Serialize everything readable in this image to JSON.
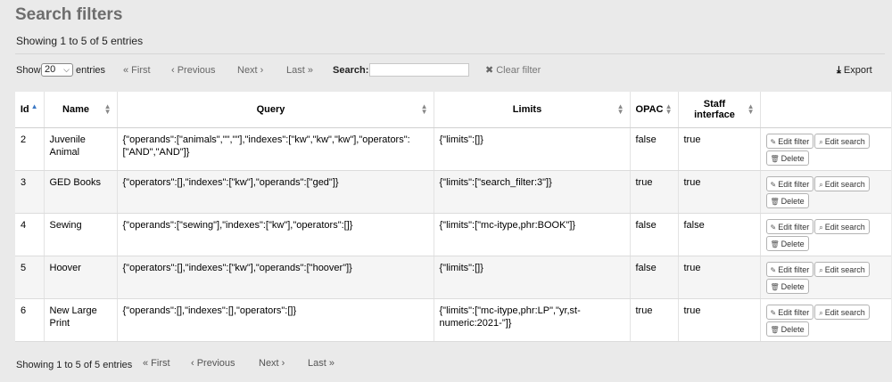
{
  "page": {
    "title": "Search filters",
    "info_top": "Showing 1 to 5 of 5 entries",
    "info_bottom": "Showing 1 to 5 of 5 entries"
  },
  "toolbar": {
    "show_label": "Show",
    "show_value": "20",
    "entries_label": "entries",
    "first": "« First",
    "previous": "‹ Previous",
    "next": "Next ›",
    "last": "Last »",
    "search_label": "Search:",
    "search_value": "",
    "clear_filter": "Clear filter",
    "export": "Export"
  },
  "table": {
    "headers": [
      "Id",
      "Name",
      "Query",
      "Limits",
      "OPAC",
      "Staff interface",
      ""
    ],
    "rows": [
      {
        "id": "2",
        "name": "Juvenile Animal",
        "query": "{\"operands\":[\"animals\",\"\",\"\"],\"indexes\":[\"kw\",\"kw\",\"kw\"],\"operators\":[\"AND\",\"AND\"]}",
        "limits": "{\"limits\":[]}",
        "opac": "false",
        "staff": "true"
      },
      {
        "id": "3",
        "name": "GED Books",
        "query": "{\"operators\":[],\"indexes\":[\"kw\"],\"operands\":[\"ged\"]}",
        "limits": "{\"limits\":[\"search_filter:3\"]}",
        "opac": "true",
        "staff": "true"
      },
      {
        "id": "4",
        "name": "Sewing",
        "query": "{\"operands\":[\"sewing\"],\"indexes\":[\"kw\"],\"operators\":[]}",
        "limits": "{\"limits\":[\"mc-itype,phr:BOOK\"]}",
        "opac": "false",
        "staff": "false"
      },
      {
        "id": "5",
        "name": "Hoover",
        "query": "{\"operators\":[],\"indexes\":[\"kw\"],\"operands\":[\"hoover\"]}",
        "limits": "{\"limits\":[]}",
        "opac": "false",
        "staff": "true"
      },
      {
        "id": "6",
        "name": "New Large Print",
        "query": "{\"operands\":[],\"indexes\":[],\"operators\":[]}",
        "limits": "{\"limits\":[\"mc-itype,phr:LP\",\"yr,st-numeric:2021-\"]}",
        "opac": "true",
        "staff": "true"
      }
    ],
    "actions": {
      "edit_filter": "Edit filter",
      "edit_search": "Edit search",
      "delete": "Delete"
    }
  },
  "colors": {
    "title": "#6d6d6d",
    "background": "#eaeaea",
    "sort_active": "#3b78c4"
  },
  "icons": {
    "sort_active": "sort-ascending-icon",
    "sort": "sort-icon",
    "clear": "close-icon",
    "export": "download-icon",
    "edit": "pencil-icon",
    "search": "search-icon",
    "delete": "trash-icon"
  }
}
